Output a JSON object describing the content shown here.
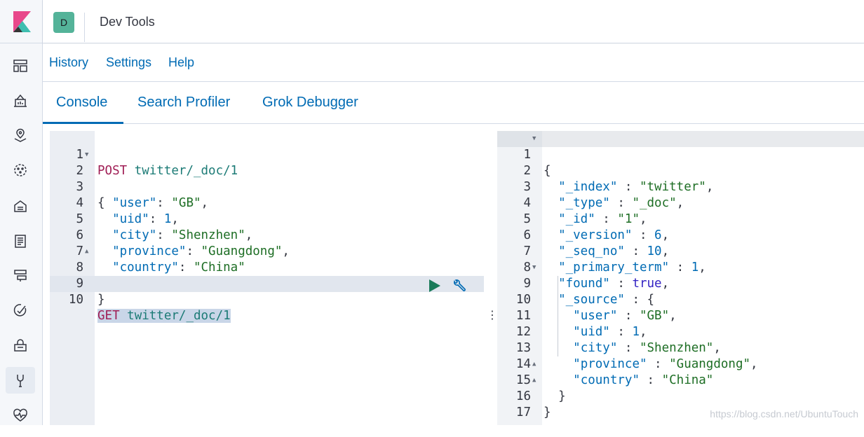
{
  "header": {
    "space_initial": "D",
    "app_title": "Dev Tools"
  },
  "nav_icons": [
    "dashboard-icon",
    "canvas-icon",
    "maps-icon",
    "ml-icon",
    "infrastructure-icon",
    "logs-icon",
    "apm-icon",
    "uptime-icon",
    "siem-icon",
    "devtools-icon",
    "monitoring-icon"
  ],
  "topnav": {
    "links": [
      "History",
      "Settings",
      "Help"
    ]
  },
  "tabs": {
    "items": [
      "Console",
      "Search Profiler",
      "Grok Debugger"
    ],
    "active": "Console"
  },
  "request": {
    "line_numbers": [
      "1",
      "2",
      "3",
      "4",
      "5",
      "6",
      "7",
      "8",
      "9",
      "10"
    ],
    "line1_method": "POST",
    "line1_url": "twitter/_doc/1",
    "line2": "{",
    "line3_key": "\"user\"",
    "line3_val": "\"GB\"",
    "line4_key": "\"uid\"",
    "line4_val": "1",
    "line5_key": "\"city\"",
    "line5_val": "\"Shenzhen\"",
    "line6_key": "\"province\"",
    "line6_val": "\"Guangdong\"",
    "line7_key": "\"country\"",
    "line7_val": "\"China\"",
    "line8": "}",
    "line10_method": "GET",
    "line10_url": "twitter/_doc/1"
  },
  "response": {
    "line_numbers": [
      "1",
      "2",
      "3",
      "4",
      "5",
      "6",
      "7",
      "8",
      "9",
      "10",
      "11",
      "12",
      "13",
      "14",
      "15",
      "16",
      "17"
    ],
    "l1": "{",
    "l2_key": "\"_index\"",
    "l2_val": "\"twitter\"",
    "l3_key": "\"_type\"",
    "l3_val": "\"_doc\"",
    "l4_key": "\"_id\"",
    "l4_val": "\"1\"",
    "l5_key": "\"_version\"",
    "l5_val": "6",
    "l6_key": "\"_seq_no\"",
    "l6_val": "10",
    "l7_key": "\"_primary_term\"",
    "l7_val": "1",
    "l8_key": "\"found\"",
    "l8_val": "true",
    "l9_key": "\"_source\"",
    "l10_key": "\"user\"",
    "l10_val": "\"GB\"",
    "l11_key": "\"uid\"",
    "l11_val": "1",
    "l12_key": "\"city\"",
    "l12_val": "\"Shenzhen\"",
    "l13_key": "\"province\"",
    "l13_val": "\"Guangdong\"",
    "l14_key": "\"country\"",
    "l14_val": "\"China\"",
    "l15": "}",
    "l16": "}"
  },
  "watermark": "https://blog.csdn.net/UbuntuTouch",
  "colors": {
    "accent": "#006bb4",
    "method": "#a01e55",
    "url": "#1c7b76",
    "string": "#1e6e25",
    "bool": "#3322c3",
    "space_avatar": "#54b399"
  }
}
